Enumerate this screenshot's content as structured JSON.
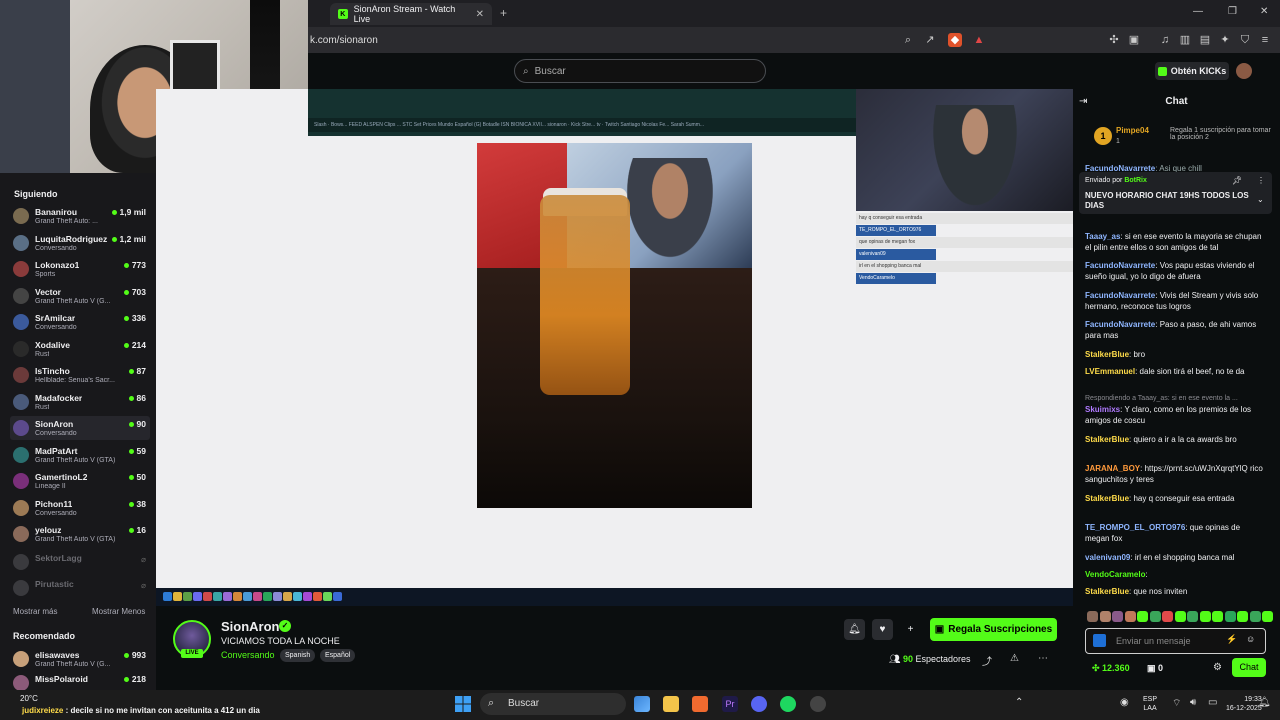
{
  "browser": {
    "tab_title": "SionAron Stream - Watch Live",
    "url": "k.com/sionaron",
    "tab_icon": "K",
    "tab_close": "✕",
    "new_tab": "+"
  },
  "header": {
    "search_placeholder": "Buscar",
    "get_kicks": "Obtén KICKs"
  },
  "sidebar": {
    "following_title": "Siguiendo",
    "channels": [
      {
        "name": "Bananirou",
        "game": "Grand Theft Auto: ...",
        "viewers": "1,9 mil",
        "color": "#7a6b50"
      },
      {
        "name": "LuquitaRodriguez",
        "game": "Conversando",
        "viewers": "1,2 mil",
        "color": "#5a6f86"
      },
      {
        "name": "Lokonazo1",
        "game": "Sports",
        "viewers": "773",
        "color": "#8a3b3b"
      },
      {
        "name": "Vector",
        "game": "Grand Theft Auto V (G...",
        "viewers": "703",
        "color": "#444"
      },
      {
        "name": "SrAmilcar",
        "game": "Conversando",
        "viewers": "336",
        "color": "#3b5a9c"
      },
      {
        "name": "Xodalive",
        "game": "Rust",
        "viewers": "214",
        "color": "#2a2a2a"
      },
      {
        "name": "IsTincho",
        "game": "Hellblade: Senua's Sacr...",
        "viewers": "87",
        "color": "#6b3a3a"
      },
      {
        "name": "Madafocker",
        "game": "Rust",
        "viewers": "86",
        "color": "#4a5a7a"
      },
      {
        "name": "SionAron",
        "game": "Conversando",
        "viewers": "90",
        "color": "#5c4a8c"
      },
      {
        "name": "MadPatArt",
        "game": "Grand Theft Auto V (GTA)",
        "viewers": "59",
        "color": "#2b6f6f"
      },
      {
        "name": "GamertinoL2",
        "game": "Lineage II",
        "viewers": "50",
        "color": "#7a2f7a"
      },
      {
        "name": "Pichon11",
        "game": "Conversando",
        "viewers": "38",
        "color": "#9c7a55"
      },
      {
        "name": "yelouz",
        "game": "Grand Theft Auto V (GTA)",
        "viewers": "16",
        "color": "#8a6a5a"
      }
    ],
    "offline": [
      {
        "name": "SektorLagg"
      },
      {
        "name": "Pirutastic"
      }
    ],
    "show_more": "Mostrar más",
    "show_less": "Mostrar Menos",
    "recommended_title": "Recomendado",
    "recommended": [
      {
        "name": "elisawaves",
        "game": "Grand Theft Auto V (G...",
        "viewers": "993",
        "color": "#c7a07a"
      },
      {
        "name": "MissPolaroid",
        "game": "",
        "viewers": "218",
        "color": "#8c5a7a"
      }
    ]
  },
  "stream": {
    "channel": "SionAron",
    "title": "VICIAMOS TODA LA NOCHE",
    "category": "Conversando",
    "tags": [
      "Spanish",
      "Español"
    ],
    "live": "LIVE",
    "gift_subs": "Regala Suscripciones",
    "viewers_count": "90",
    "viewers_label": "Espectadores",
    "bookmarks_text": "Slash · Bows...   FEED ALSPEN   Clips   ...   STC Set Prices   Mundo Español (G)   Botadle   ISN BIONICA XVII...   sionaron · Kick Stre...   tv · Twitch   Santiago Nicolas Fe...   Sarah Summ...",
    "mini_chat": [
      "hay q conseguir esa entrada",
      "TE_ROMPO_EL_ORTO976",
      "que opinas de megan fox",
      "valenivan09",
      "irl en el shopping banca mal",
      "VendoCaramelo"
    ]
  },
  "chat": {
    "title": "Chat",
    "top_gifter": {
      "rank": "1",
      "name": "Pimpe04",
      "count": "1",
      "cta": "Regala 1 suscripción para tomar la posición 2"
    },
    "pinned": {
      "by_label": "Enviado por",
      "by_user": "BotRix",
      "text": "NUEVO HORARIO CHAT 19HS TODOS LOS DIAS"
    },
    "messages": [
      {
        "user": "Taaay_as",
        "color": "#8fb6ff",
        "text": "si en ese evento la mayoria se chupan el pilin entre ellos o son amigos de tal"
      },
      {
        "user": "FacundoNavarrete",
        "color": "#8fb6ff",
        "text": "Vos papu estas viviendo el sueño igual, yo lo digo de afuera"
      },
      {
        "user": "FacundoNavarrete",
        "color": "#8fb6ff",
        "text": "Vivis del Stream y vivis solo hermano, reconoce tus logros"
      },
      {
        "user": "FacundoNavarrete",
        "color": "#8fb6ff",
        "text": "Paso a paso, de ahi vamos para mas"
      },
      {
        "user": "StalkerBlue",
        "color": "#ffdc4a",
        "text": "bro"
      },
      {
        "user": "LVEmmanuel",
        "color": "#ffdc4a",
        "text": "dale sion tirá el beef, no te da"
      },
      {
        "user": "Skuimixs",
        "color": "#b07aff",
        "text": "Y claro, como en los premios de los amigos de coscu"
      },
      {
        "user": "StalkerBlue",
        "color": "#ffdc4a",
        "text": "quiero a ir a la ca awards bro"
      },
      {
        "user": "JARANA_BOY",
        "color": "#ff9a3c",
        "text": "https://prnt.sc/uWJnXqrqtYlQ rico sanguchitos y teres"
      },
      {
        "user": "StalkerBlue",
        "color": "#ffdc4a",
        "text": "hay q conseguir esa entrada"
      },
      {
        "user": "TE_ROMPO_EL_ORTO976",
        "color": "#8fb6ff",
        "text": "que opinas de megan fox"
      },
      {
        "user": "valenivan09",
        "color": "#8fb6ff",
        "text": "irl en el shopping banca mal"
      },
      {
        "user": "VendoCaramelo",
        "color": "#53fc18",
        "text": ""
      },
      {
        "user": "StalkerBlue",
        "color": "#ffdc4a",
        "text": "que nos inviten"
      }
    ],
    "reply_note": "Respondiendo a Taaay_as: si en ese evento la ...",
    "partial_user": "FacundoNavarrete",
    "partial_text": "Asi que chill",
    "input_placeholder": "Enviar un mensaje",
    "kicks_balance": "12.360",
    "points": "0",
    "send": "Chat"
  },
  "taskbar": {
    "weather": "20°C",
    "ticker_user": "judixreieze",
    "ticker_text": "decile si no me invitan con aceitunita a 412 un dia",
    "search": "Buscar",
    "lang_1": "ESP",
    "lang_2": "LAA",
    "time": "19:33",
    "date": "16-12-2025"
  },
  "colors": {
    "accent": "#53fc18",
    "bg": "#0b0e0f",
    "panel": "#18181b"
  }
}
